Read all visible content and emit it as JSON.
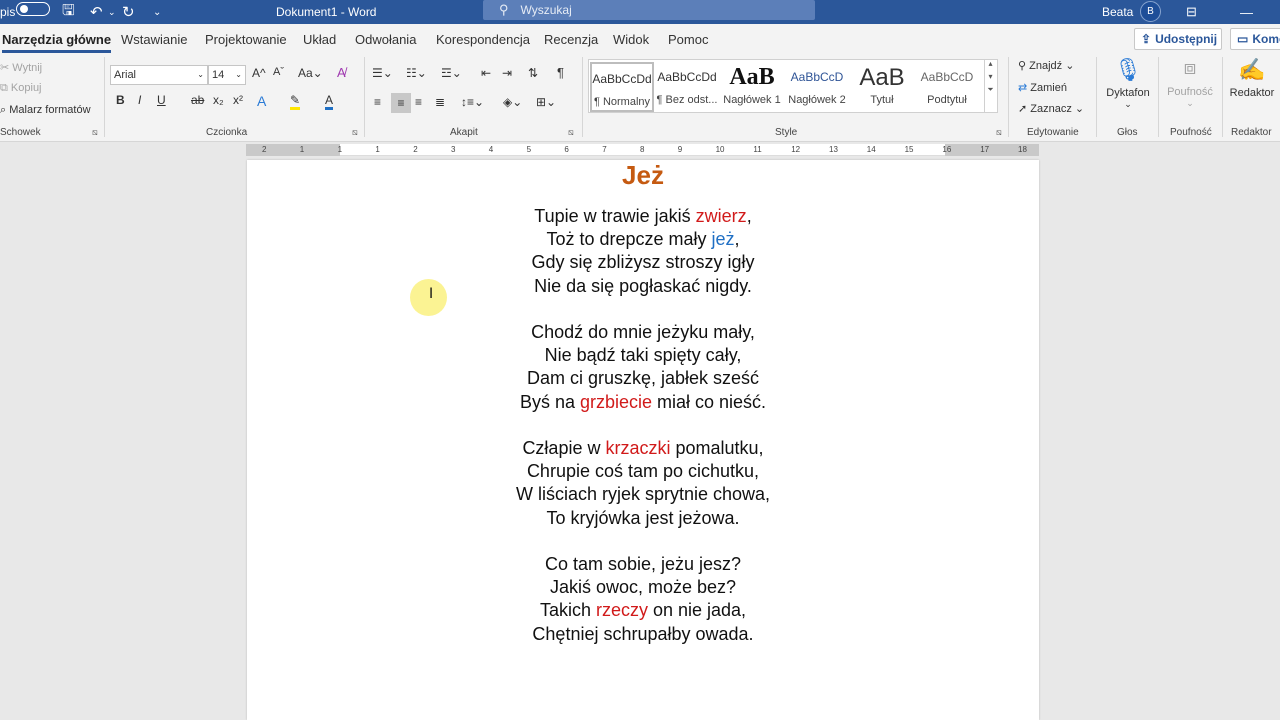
{
  "titlebar": {
    "autosave_label": "pis",
    "doc_title": "Dokument1  -  Word",
    "search_placeholder": "Wyszukaj",
    "user_name": "Beata",
    "user_initial": "B"
  },
  "tabs": [
    "Narzędzia główne",
    "Wstawianie",
    "Projektowanie",
    "Układ",
    "Odwołania",
    "Korespondencja",
    "Recenzja",
    "Widok",
    "Pomoc"
  ],
  "share_label": "Udostępnij",
  "comments_label": "Kome",
  "clipboard": {
    "cut": "Wytnij",
    "copy": "Kopiuj",
    "painter": "Malarz formatów",
    "group": "Schowek"
  },
  "font": {
    "name": "Arial",
    "size": "14",
    "group": "Czcionka"
  },
  "paragraph_group": "Akapit",
  "styles": {
    "group": "Style",
    "items": [
      {
        "preview": "AaBbCcDd",
        "name": "¶ Normalny"
      },
      {
        "preview": "AaBbCcDd",
        "name": "¶ Bez odst..."
      },
      {
        "preview": "AaB",
        "name": "Nagłówek 1"
      },
      {
        "preview": "AaBbCcD",
        "name": "Nagłówek 2"
      },
      {
        "preview": "AaB",
        "name": "Tytuł"
      },
      {
        "preview": "AaBbCcD",
        "name": "Podtytuł"
      }
    ]
  },
  "editing": {
    "find": "Znajdź",
    "replace": "Zamień",
    "select": "Zaznacz",
    "group": "Edytowanie"
  },
  "voice": {
    "dictate": "Dyktafon",
    "group": "Głos"
  },
  "sensitivity": {
    "label": "Poufność",
    "group": "Poufność"
  },
  "editor": {
    "label": "Redaktor",
    "group": "Redaktor"
  },
  "ruler_numbers": [
    "2",
    "1",
    "1",
    "1",
    "2",
    "3",
    "4",
    "5",
    "6",
    "7",
    "8",
    "9",
    "10",
    "11",
    "12",
    "13",
    "14",
    "15",
    "16",
    "17",
    "18"
  ],
  "document": {
    "heading": "Jeż",
    "stanzas": [
      [
        {
          "parts": [
            {
              "t": "Tupie w trawie jakiś "
            },
            {
              "t": "zwierz",
              "c": "red"
            },
            {
              "t": ","
            }
          ]
        },
        {
          "parts": [
            {
              "t": "Toż to drepcze mały "
            },
            {
              "t": "jeż",
              "c": "blue"
            },
            {
              "t": ","
            }
          ]
        },
        {
          "parts": [
            {
              "t": "Gdy się zbliżysz stroszy igły"
            }
          ]
        },
        {
          "parts": [
            {
              "t": "Nie da się pogłaskać nigdy."
            }
          ]
        }
      ],
      [
        {
          "parts": [
            {
              "t": "Chodź do mnie jeżyku mały,"
            }
          ]
        },
        {
          "parts": [
            {
              "t": "Nie bądź taki spięty cały,"
            }
          ]
        },
        {
          "parts": [
            {
              "t": "Dam ci gruszkę, jabłek sześć"
            }
          ]
        },
        {
          "parts": [
            {
              "t": "Byś na "
            },
            {
              "t": "grzbiecie",
              "c": "red"
            },
            {
              "t": " miał co nieść."
            }
          ]
        }
      ],
      [
        {
          "parts": [
            {
              "t": "Człapie w "
            },
            {
              "t": "krzaczki",
              "c": "red"
            },
            {
              "t": " pomalutku,"
            }
          ]
        },
        {
          "parts": [
            {
              "t": "Chrupie coś tam po cichutku,"
            }
          ]
        },
        {
          "parts": [
            {
              "t": "W liściach ryjek sprytnie chowa,"
            }
          ]
        },
        {
          "parts": [
            {
              "t": "To kryjówka jest jeżowa."
            }
          ]
        }
      ],
      [
        {
          "parts": [
            {
              "t": "Co tam sobie, jeżu jesz?"
            }
          ]
        },
        {
          "parts": [
            {
              "t": "Jakiś owoc, może bez?"
            }
          ]
        },
        {
          "parts": [
            {
              "t": "Takich "
            },
            {
              "t": "rzeczy",
              "c": "red"
            },
            {
              "t": " on nie jada,"
            }
          ]
        },
        {
          "parts": [
            {
              "t": "Chętniej schrupałby owada."
            }
          ]
        }
      ]
    ]
  }
}
